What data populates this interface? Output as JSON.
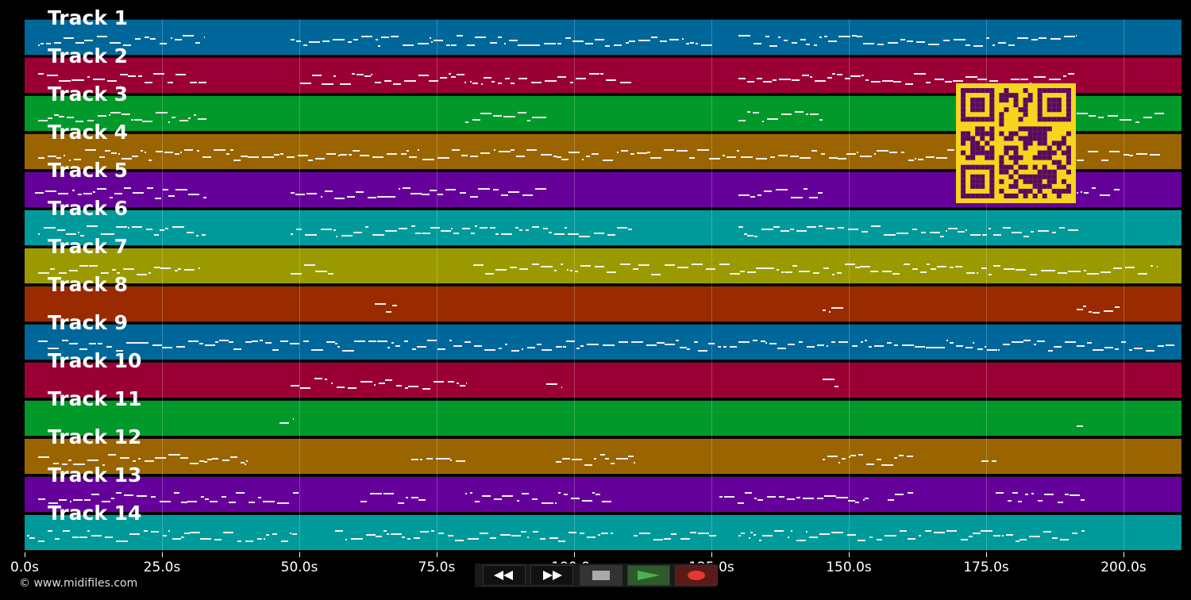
{
  "tracks": [
    {
      "label": "Track 1",
      "color": "#00679a"
    },
    {
      "label": "Track 2",
      "color": "#9a0035"
    },
    {
      "label": "Track 3",
      "color": "#00992a"
    },
    {
      "label": "Track 4",
      "color": "#9a6500"
    },
    {
      "label": "Track 5",
      "color": "#66009a"
    },
    {
      "label": "Track 6",
      "color": "#009a9a"
    },
    {
      "label": "Track 7",
      "color": "#9a9a00"
    },
    {
      "label": "Track 8",
      "color": "#9a2a00"
    },
    {
      "label": "Track 9",
      "color": "#00679a"
    },
    {
      "label": "Track 10",
      "color": "#9a0035"
    },
    {
      "label": "Track 11",
      "color": "#00992a"
    },
    {
      "label": "Track 12",
      "color": "#9a6500"
    },
    {
      "label": "Track 13",
      "color": "#66009a"
    },
    {
      "label": "Track 14",
      "color": "#009a9a"
    }
  ],
  "timeline": {
    "unit": "s",
    "ticks": [
      "0.0s",
      "25.0s",
      "50.0s",
      "75.0s",
      "100.0s",
      "125.0s",
      "150.0s",
      "175.0s",
      "200.0s"
    ]
  },
  "copyright": "© www.midifiles.com",
  "transport": {
    "rewind_icon": "rewind-icon",
    "forward_icon": "fast-forward-icon",
    "stop_icon": "stop-icon",
    "play_icon": "play-icon",
    "record_icon": "record-icon",
    "play_color": "#4caf50",
    "record_color": "#e53935"
  },
  "qr_code_color": "#f7d51d"
}
